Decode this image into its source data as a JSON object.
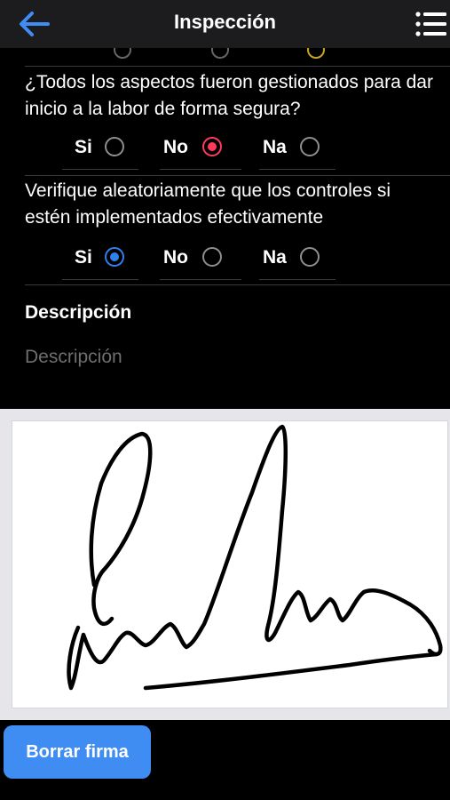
{
  "header": {
    "title": "Inspección",
    "back_icon": "arrow-left-icon",
    "menu_icon": "list-menu-icon",
    "accent_color": "#3f8cf3"
  },
  "questions": [
    {
      "text": "¿Todos los aspectos fueron gestionados para dar inicio a la labor de forma segura?",
      "options": [
        "Si",
        "No",
        "Na"
      ],
      "selected": "No",
      "selected_color": "#ff3b5c"
    },
    {
      "text": "Verifique aleatoriamente que los controles si estén implementados efectivamente",
      "options": [
        "Si",
        "No",
        "Na"
      ],
      "selected": "Si",
      "selected_color": "#2f80ed"
    }
  ],
  "description": {
    "label": "Descripción",
    "placeholder": "Descripción",
    "value": ""
  },
  "signature": {
    "has_signature": true
  },
  "actions": {
    "clear_signature_label": "Borrar firma"
  }
}
